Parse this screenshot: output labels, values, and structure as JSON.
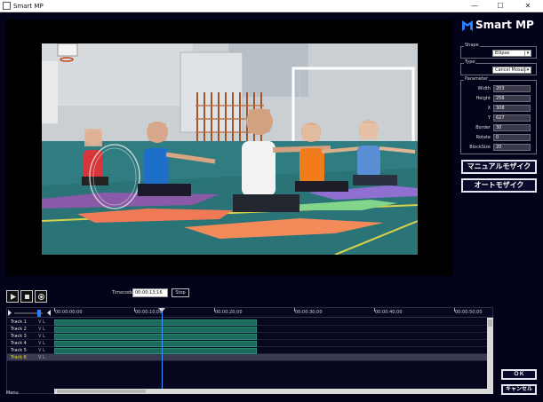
{
  "window": {
    "title": "Smart MP",
    "minimize_glyph": "—",
    "maximize_glyph": "☐",
    "close_glyph": "✕"
  },
  "brand": {
    "logo_text": "Smart MP",
    "logo_color": "#2c7fff"
  },
  "shape_group": {
    "legend": "Shape",
    "selected": "Ellipse"
  },
  "type_group": {
    "legend": "Type",
    "selected": "Cancel Mosaic"
  },
  "parameter_group": {
    "legend": "Parameter",
    "fields": [
      {
        "label": "Width",
        "value": "203"
      },
      {
        "label": "Height",
        "value": "256"
      },
      {
        "label": "X",
        "value": "308"
      },
      {
        "label": "Y",
        "value": "627"
      },
      {
        "label": "Border",
        "value": "30"
      },
      {
        "label": "Rotate",
        "value": "0"
      },
      {
        "label": "BlockSize",
        "value": "20"
      }
    ]
  },
  "buttons": {
    "manual_mosaic": "マニュアルモザイク",
    "auto_mosaic": "オートモザイク",
    "ok": "ＯＫ",
    "cancel": "キャンセル"
  },
  "playback": {
    "timecode_label": "Timecode",
    "timecode_value": "00:00:13;16",
    "stop_label": "Stop"
  },
  "timeline": {
    "ticks": [
      "00:00:00;00",
      "00:00:10;00",
      "00:00:20;00",
      "00:00:30;00",
      "00:00:40;00",
      "00:00:50;00"
    ],
    "tracks": [
      {
        "name": "Track 1",
        "vl": "V  L",
        "has_clip": true,
        "selected": false
      },
      {
        "name": "Track 2",
        "vl": "V  L",
        "has_clip": true,
        "selected": false
      },
      {
        "name": "Track 3",
        "vl": "V  L",
        "has_clip": true,
        "selected": false
      },
      {
        "name": "Track 4",
        "vl": "V  L",
        "has_clip": true,
        "selected": false
      },
      {
        "name": "Track 5",
        "vl": "V  L",
        "has_clip": true,
        "selected": false
      },
      {
        "name": "Track 6",
        "vl": "V  L",
        "has_clip": false,
        "selected": true
      }
    ]
  },
  "footer": {
    "menu_label": "Menu"
  },
  "colors": {
    "background": "#020218",
    "clip": "#1b6b5a",
    "playhead": "#3a8bff",
    "selected_track": "#f0e000"
  }
}
